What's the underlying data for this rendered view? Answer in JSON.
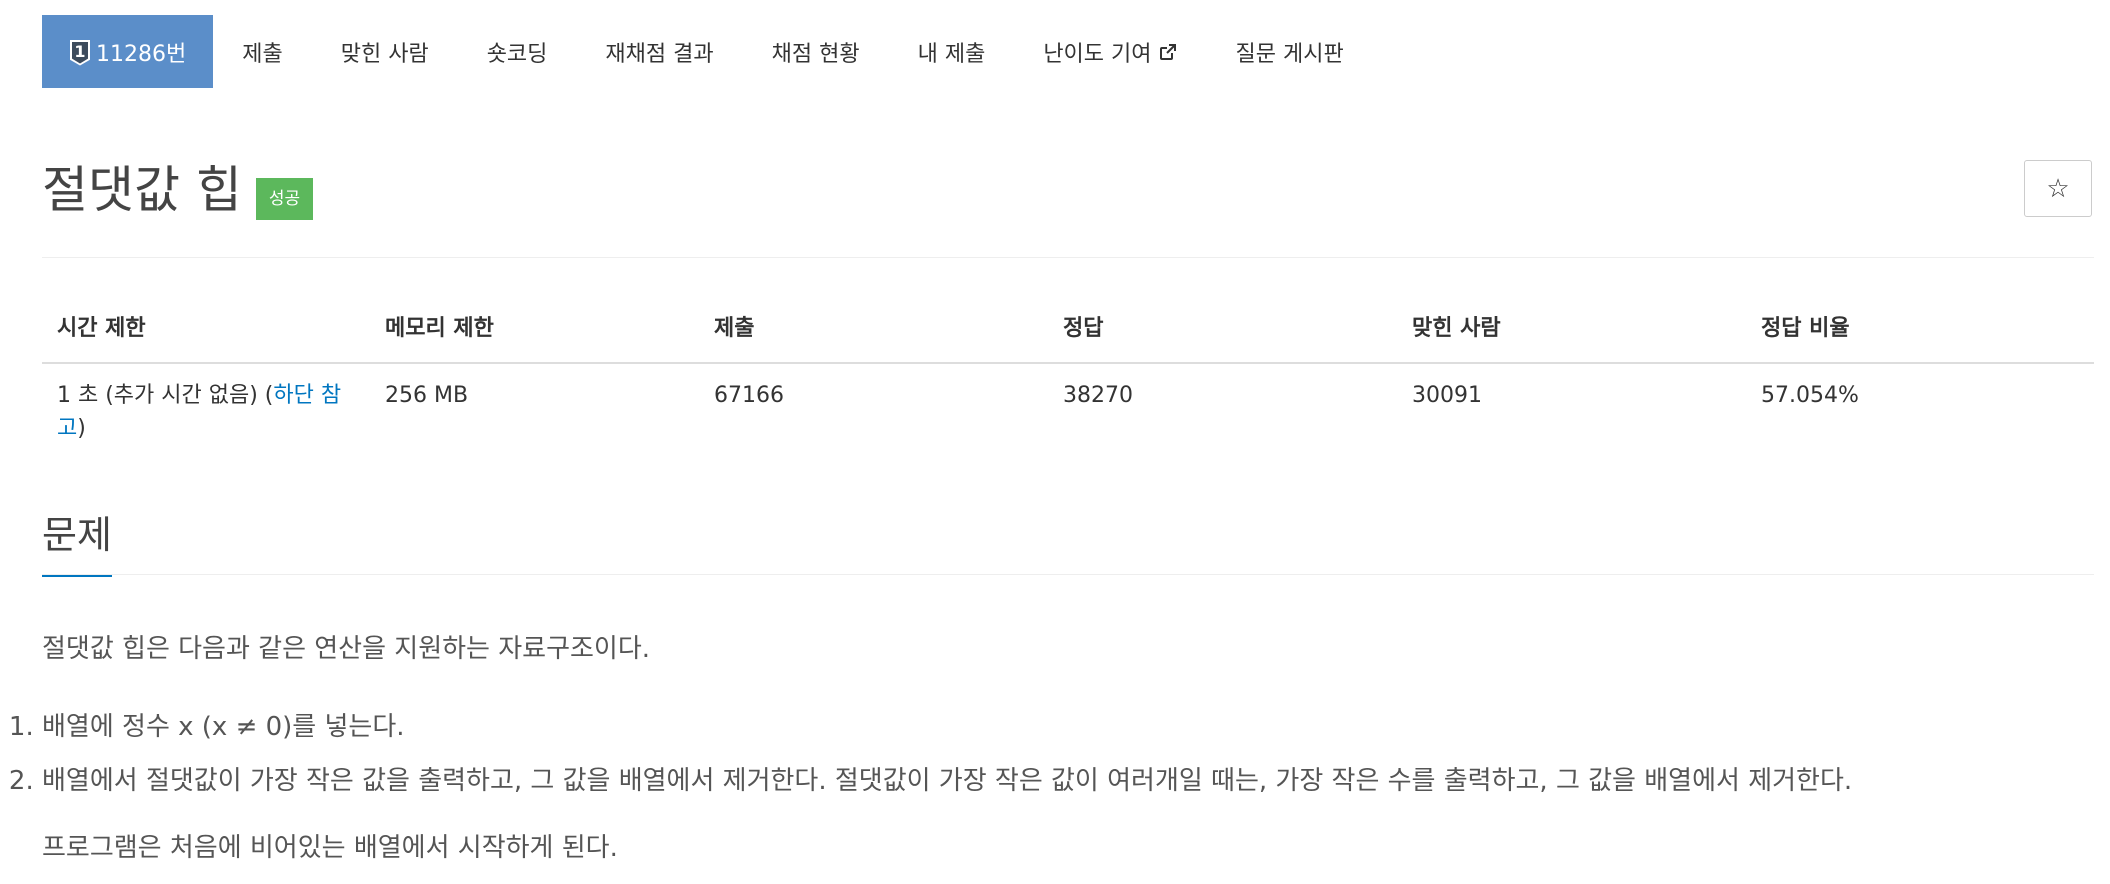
{
  "tabs": [
    {
      "label": "11286번",
      "badge": "1"
    },
    {
      "label": "제출"
    },
    {
      "label": "맞힌 사람"
    },
    {
      "label": "숏코딩"
    },
    {
      "label": "재채점 결과"
    },
    {
      "label": "채점 현황"
    },
    {
      "label": "내 제출"
    },
    {
      "label": "난이도 기여"
    },
    {
      "label": "질문 게시판"
    }
  ],
  "problem": {
    "title": "절댓값 힙",
    "status": "성공",
    "star": "☆"
  },
  "info_table": {
    "headers": [
      "시간 제한",
      "메모리 제한",
      "제출",
      "정답",
      "맞힌 사람",
      "정답 비율"
    ],
    "time_limit_prefix": "1 초 (추가 시간 없음) (",
    "time_limit_link": "하단 참고",
    "time_limit_suffix": ")",
    "memory_limit": "256 MB",
    "submissions": "67166",
    "accepted": "38270",
    "solved_users": "30091",
    "accept_ratio": "57.054%"
  },
  "section": {
    "title": "문제",
    "intro": "절댓값 힙은 다음과 같은 연산을 지원하는 자료구조이다.",
    "items": [
      "배열에 정수 x (x ≠ 0)를 넣는다.",
      "배열에서 절댓값이 가장 작은 값을 출력하고, 그 값을 배열에서 제거한다. 절댓값이 가장 작은 값이 여러개일 때는, 가장 작은 수를 출력하고, 그 값을 배열에서 제거한다."
    ],
    "outro": "프로그램은 처음에 비어있는 배열에서 시작하게 된다."
  },
  "colors": {
    "active_tab": "#5b8ec9",
    "success": "#5cb85c",
    "link": "#0076c0"
  }
}
